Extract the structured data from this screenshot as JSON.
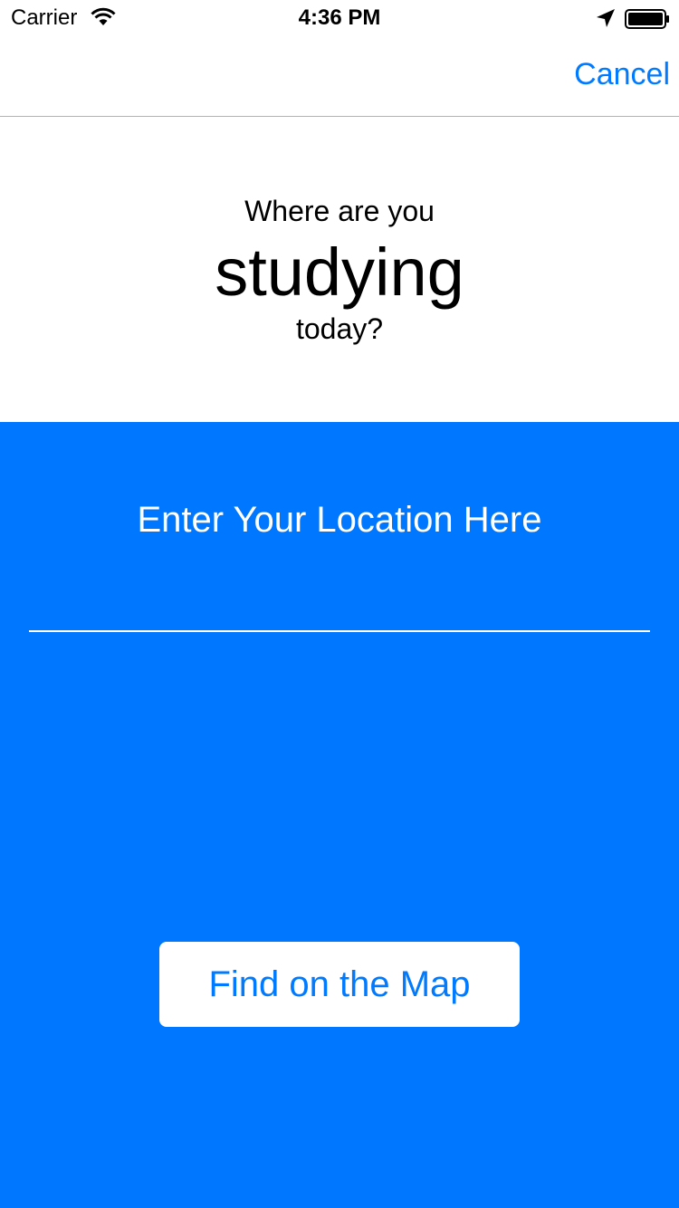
{
  "status_bar": {
    "carrier": "Carrier",
    "time": "4:36 PM",
    "icons": [
      "wifi-icon",
      "location-arrow-icon",
      "battery-icon"
    ]
  },
  "nav": {
    "cancel_label": "Cancel"
  },
  "prompt": {
    "line1": "Where are you",
    "line2": "studying",
    "line3": "today?"
  },
  "location": {
    "placeholder": "Enter Your Location Here",
    "value": ""
  },
  "find_button": {
    "label": "Find on the Map"
  },
  "colors": {
    "accent": "#007aff",
    "panel_background": "#0077ff",
    "background": "#ffffff"
  }
}
